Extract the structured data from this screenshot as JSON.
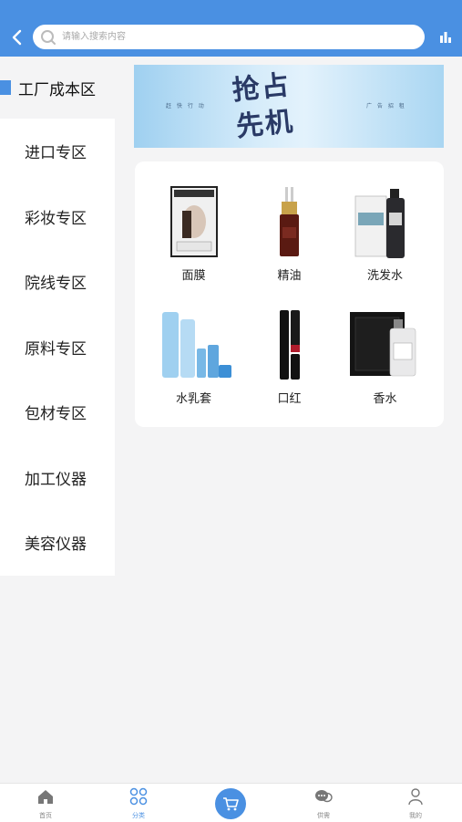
{
  "header": {
    "search_placeholder": "请输入搜索内容"
  },
  "sidebar": {
    "active": "工厂成本区",
    "items": [
      {
        "label": "进口专区"
      },
      {
        "label": "彩妆专区"
      },
      {
        "label": "院线专区"
      },
      {
        "label": "原料专区"
      },
      {
        "label": "包材专区"
      },
      {
        "label": "加工仪器"
      },
      {
        "label": "美容仪器"
      }
    ]
  },
  "banner": {
    "title_line1": "抢占",
    "title_line2": "先机",
    "left_text": "赶 快 行 动",
    "right_text": "广 告 招 租"
  },
  "products": [
    {
      "label": "面膜",
      "icon": "face-mask-product-icon"
    },
    {
      "label": "精油",
      "icon": "essential-oil-product-icon"
    },
    {
      "label": "洗发水",
      "icon": "shampoo-product-icon"
    },
    {
      "label": "水乳套",
      "icon": "skincare-set-product-icon"
    },
    {
      "label": "口红",
      "icon": "lipstick-product-icon"
    },
    {
      "label": "香水",
      "icon": "perfume-product-icon"
    }
  ],
  "tabbar": {
    "home": "首页",
    "category": "分类",
    "cart_icon": "cart-icon",
    "supply": "供需",
    "mine": "我的"
  },
  "colors": {
    "accent": "#4a90e2",
    "background": "#f4f4f5"
  }
}
